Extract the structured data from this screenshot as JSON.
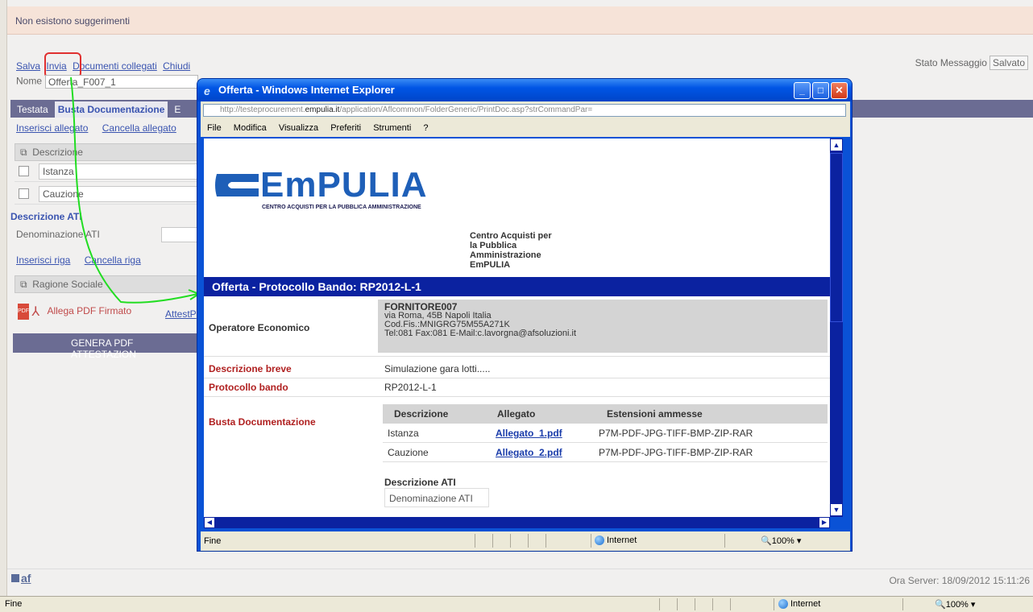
{
  "suggestions": {
    "text": "Non esistono suggerimenti"
  },
  "toolbar": {
    "salva": "Salva",
    "invia": "Invia",
    "documenti": "Documenti collegati",
    "chiudi": "Chiudi"
  },
  "stato": {
    "label": "Stato Messaggio",
    "value": "Salvato"
  },
  "nome": {
    "label": "Nome",
    "value": "Offerta_F007_1"
  },
  "tabs": [
    {
      "label": "Testata"
    },
    {
      "label": "Busta Documentazione"
    },
    {
      "label": "E"
    }
  ],
  "actions1": {
    "insert": "Inserisci allegato",
    "delete": "Cancella allegato"
  },
  "grid1": {
    "header": "Descrizione",
    "rows": [
      "Istanza",
      "Cauzione"
    ]
  },
  "ati": {
    "title": "Descrizione ATI",
    "denom_label": "Denominazione ATI"
  },
  "actions2": {
    "insert": "Inserisci riga",
    "delete": "Cancella riga"
  },
  "grid2": {
    "header": "Ragione Sociale"
  },
  "allega": {
    "label": "Allega PDF Firmato",
    "attest": "AttestP"
  },
  "genera": {
    "label": "GENERA PDF ATTESTAZION"
  },
  "footer": {
    "logo": "af",
    "server_time": "Ora Server: 18/09/2012 15:11:26"
  },
  "statusbar": {
    "left": "Fine",
    "zone": "Internet",
    "zoom": "100%"
  },
  "popup": {
    "title": "Offerta - Windows Internet Explorer",
    "url_prefix": "http://testeprocurement.",
    "url_domain": "empulia.it",
    "url_rest": "/application/Aflcommon/FolderGeneric/PrintDoc.asp?strCommandPar=",
    "menu": [
      "File",
      "Modifica",
      "Visualizza",
      "Preferiti",
      "Strumenti",
      "?"
    ],
    "logo_text": "EmPULIA",
    "logo_sub": "CENTRO ACQUISTI PER LA PUBBLICA AMMINISTRAZIONE",
    "centro": [
      "Centro Acquisti per",
      "la Pubblica",
      "Amministrazione",
      "EmPULIA"
    ],
    "band_title": "Offerta - Protocollo Bando: RP2012-L-1",
    "operatore": {
      "label": "Operatore Economico",
      "name": "FORNITORE007",
      "addr": "via Roma, 45B Napoli Italia",
      "cf": "Cod.Fis.:MNIGRG75M55A271K",
      "tel": "Tel:081 Fax:081 E-Mail:c.lavorgna@afsoluzioni.it"
    },
    "descr_breve": {
      "label": "Descrizione breve",
      "value": "Simulazione gara lotti....."
    },
    "protocollo": {
      "label": "Protocollo bando",
      "value": "RP2012-L-1"
    },
    "busta": {
      "label": "Busta Documentazione",
      "headers": [
        "Descrizione",
        "Allegato",
        "Estensioni ammesse"
      ],
      "rows": [
        {
          "descr": "Istanza",
          "file": "Allegato_1.pdf",
          "ext": "P7M-PDF-JPG-TIFF-BMP-ZIP-RAR"
        },
        {
          "descr": "Cauzione",
          "file": "Allegato_2.pdf",
          "ext": "P7M-PDF-JPG-TIFF-BMP-ZIP-RAR"
        }
      ]
    },
    "ati_title": "Descrizione ATI",
    "ati_denom": "Denominazione ATI",
    "status": {
      "left": "Fine",
      "zone": "Internet",
      "zoom": "100%"
    }
  }
}
